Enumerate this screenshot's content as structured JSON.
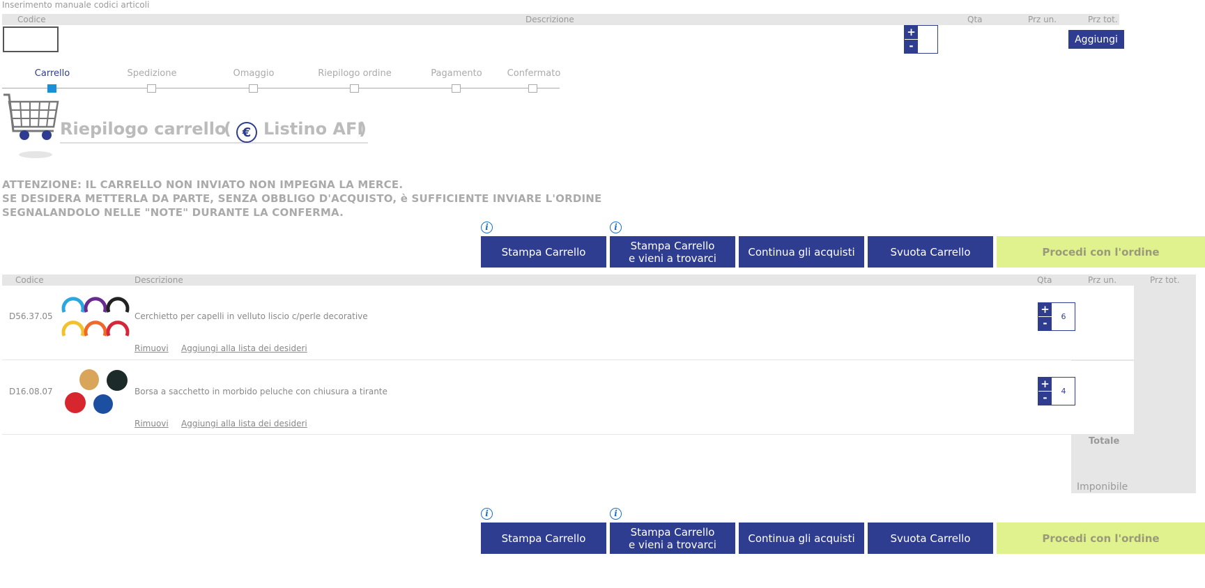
{
  "manual_entry": {
    "title": "Inserimento manuale codici articoli",
    "col_code": "Codice",
    "col_desc": "Descrizione",
    "col_qty": "Qta",
    "col_unit_price": "Prz un.",
    "col_total_price": "Prz tot.",
    "add_label": "Aggiungi",
    "plus": "+",
    "minus": "-"
  },
  "steps": [
    {
      "label": "Carrello",
      "active": true
    },
    {
      "label": "Spedizione",
      "active": false
    },
    {
      "label": "Omaggio",
      "active": false
    },
    {
      "label": "Riepilogo ordine",
      "active": false
    },
    {
      "label": "Pagamento",
      "active": false
    },
    {
      "label": "Confermato",
      "active": false
    }
  ],
  "heading": {
    "title": "Riepilogo carrello",
    "open_paren": "(",
    "euro_symbol": "€",
    "listino": "Listino AFI",
    "close_paren": ")"
  },
  "warning": {
    "line1": "ATTENZIONE: IL CARRELLO NON INVIATO NON IMPEGNA LA MERCE.",
    "line2": "SE DESIDERA METTERLA DA PARTE, SENZA OBBLIGO D'ACQUISTO, è SUFFICIENTE INVIARE L'ORDINE",
    "line3": "SEGNALANDOLO NELLE \"NOTE\" DURANTE LA CONFERMA."
  },
  "actions": {
    "print_cart": "Stampa Carrello",
    "print_visit_line1": "Stampa Carrello",
    "print_visit_line2": "e vieni a trovarci",
    "continue": "Continua gli acquisti",
    "empty": "Svuota Carrello",
    "proceed": "Procedi con l'ordine",
    "info_glyph": "i"
  },
  "cart_table": {
    "col_code": "Codice",
    "col_desc": "Descrizione",
    "col_qty": "Qta",
    "col_unit_price": "Prz un.",
    "col_total_price": "Prz tot.",
    "rows": [
      {
        "code": "D56.37.05",
        "description": "Cerchietto per capelli in velluto liscio c/perle decorative",
        "qty": "6",
        "remove": "Rimuovi",
        "wishlist": "Aggiungi alla lista dei desideri"
      },
      {
        "code": "D16.08.07",
        "description": "Borsa a sacchetto in morbido peluche con chiusura a tirante",
        "qty": "4",
        "remove": "Rimuovi",
        "wishlist": "Aggiungi alla lista dei desideri"
      }
    ],
    "total_label": "Totale",
    "taxable_label": "Imponibile"
  },
  "colors": {
    "brand_blue": "#2e3d8f",
    "proceed_green": "#e0f28d",
    "active_step": "#1a8fd8"
  }
}
